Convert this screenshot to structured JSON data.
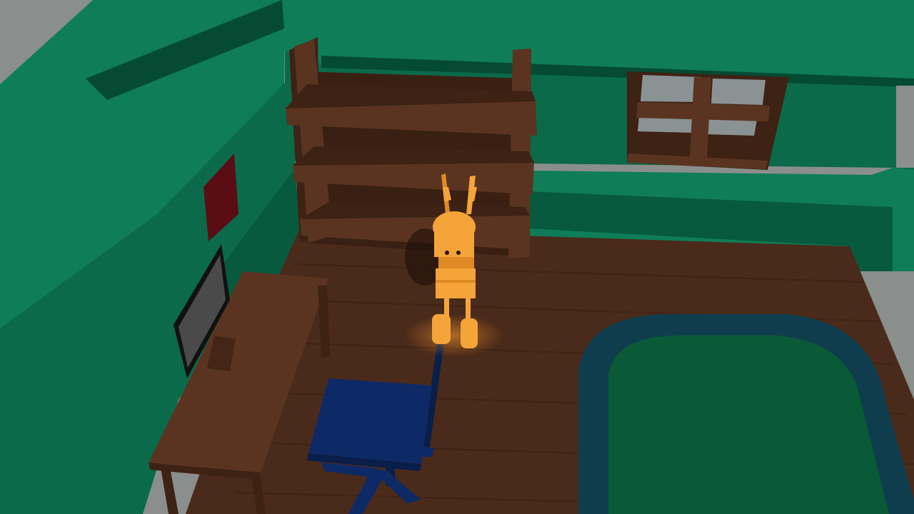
{
  "scene": {
    "colors": {
      "outside": "#8a8e8c",
      "wall_light": "#0f7d58",
      "wall_mid": "#0b6a4a",
      "wall_dark": "#075a3e",
      "wall_shadow": "#054a33",
      "floor": "#4a2a1a",
      "floor_dark": "#3a2012",
      "wood": "#5a3420",
      "wood_dark": "#3e2214",
      "rug_border": "#0f3d4e",
      "rug_center": "#0a5a38",
      "chair": "#0e2a66",
      "chair_dark": "#0a1e4a",
      "character": "#f5a43a",
      "character_shade": "#e08a25",
      "window_pane": "#8a9294",
      "poster": "#5a0d14",
      "monitor_screen": "#4a4a4a"
    },
    "objects": [
      "bookshelf",
      "window",
      "desk",
      "monitor",
      "office-chair",
      "rug",
      "player-character",
      "wall-poster"
    ]
  }
}
